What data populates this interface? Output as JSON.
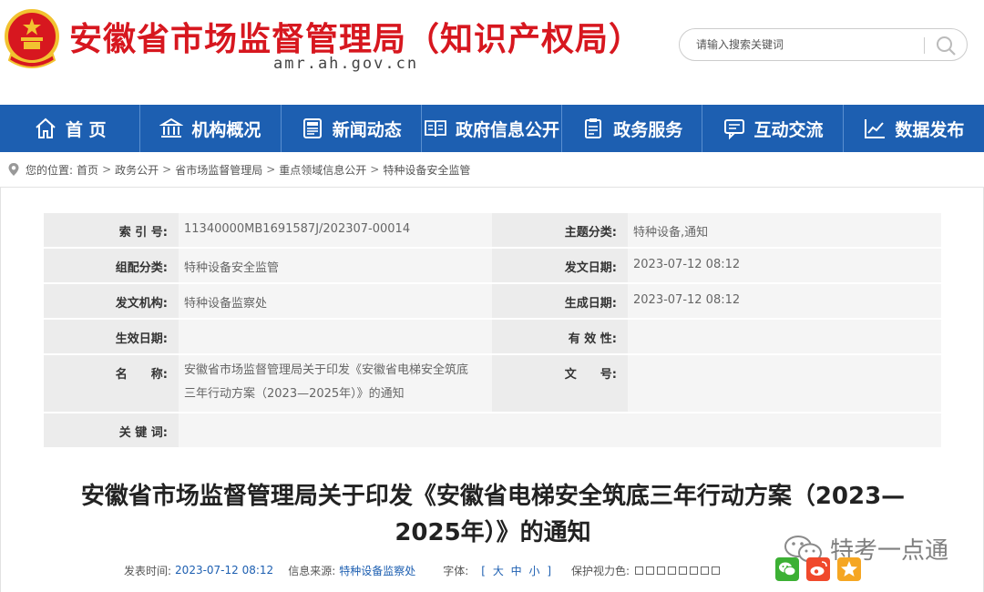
{
  "header": {
    "title": "安徽省市场监督管理局（知识产权局）",
    "domain": "amr.ah.gov.cn",
    "search_placeholder": "请输入搜索关键词"
  },
  "nav": {
    "items": [
      {
        "label": "首 页",
        "icon": "home-icon"
      },
      {
        "label": "机构概况",
        "icon": "building-icon"
      },
      {
        "label": "新闻动态",
        "icon": "newspaper-icon"
      },
      {
        "label": "政府信息公开",
        "icon": "open-book-icon"
      },
      {
        "label": "政务服务",
        "icon": "clipboard-icon"
      },
      {
        "label": "互动交流",
        "icon": "chat-icon"
      },
      {
        "label": "数据发布",
        "icon": "line-chart-icon"
      }
    ]
  },
  "breadcrumb": {
    "prefix": "您的位置:",
    "items": [
      "首页",
      "政务公开",
      "省市场监督管理局",
      "重点领域信息公开",
      "特种设备安全监管"
    ]
  },
  "info": {
    "index_label": "索 引 号:",
    "index_value": "11340000MB1691587J/202307-00014",
    "topic_label": "主题分类:",
    "topic_value": "特种设备,通知",
    "category_label": "组配分类:",
    "category_value": "特种设备安全监管",
    "issue_date_label": "发文日期:",
    "issue_date_value": "2023-07-12 08:12",
    "issuer_label": "发文机构:",
    "issuer_value": "特种设备监察处",
    "created_label": "生成日期:",
    "created_value": "2023-07-12 08:12",
    "effective_label": "生效日期:",
    "effective_value": "",
    "validity_label": "有 效 性:",
    "validity_value": "",
    "name_label": "名　　称:",
    "name_value_line1": "安徽省市场监督管理局关于印发《安徽省电梯安全筑底",
    "name_value_line2": "三年行动方案（2023—2025年）》的通知",
    "doc_no_label": "文　　号:",
    "doc_no_value": "",
    "keywords_label": "关 键 词:",
    "keywords_value": ""
  },
  "article": {
    "title_line1": "安徽省市场监督管理局关于印发《安徽省电梯安全筑底三年行动方案（2023—",
    "title_line2": "2025年）》的通知"
  },
  "meta": {
    "time_label": "发表时间:",
    "time_value": "2023-07-12 08:12",
    "source_label": "信息来源:",
    "source_value": "特种设备监察处",
    "font_label": "字体:",
    "font_open": "[",
    "font_large": "大",
    "font_medium": "中",
    "font_small": "小",
    "font_close": "]",
    "eye_label": "保护视力色:"
  },
  "watermark": "特考一点通",
  "colors": {
    "brand_red": "#d7171f",
    "nav_blue": "#1d5fb1",
    "wechat_green": "#3cb034",
    "weibo_orange": "#f0492c",
    "favorite_orange": "#f5a623"
  }
}
